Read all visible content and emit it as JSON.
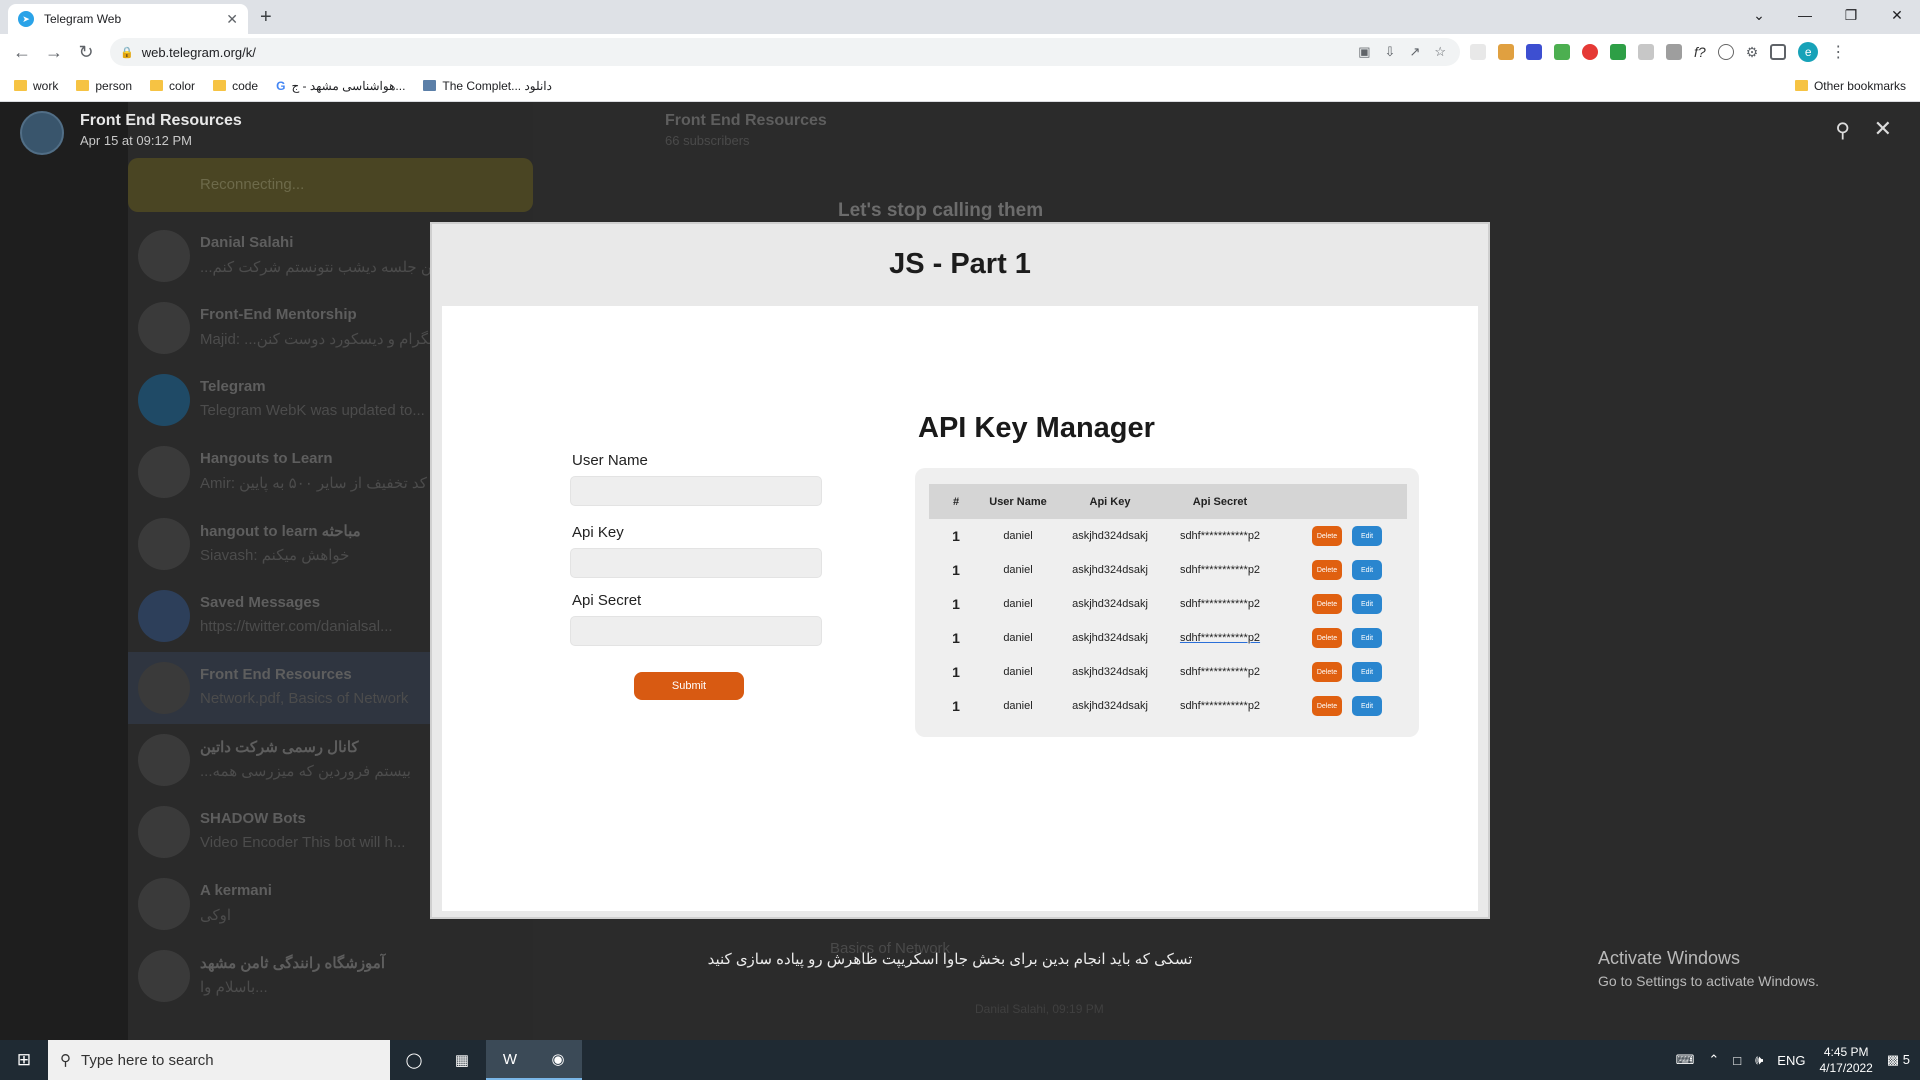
{
  "browser": {
    "tab_title": "Telegram Web",
    "url": "web.telegram.org/k/",
    "profile_initial": "e",
    "bookmarks": [
      "work",
      "person",
      "color",
      "code",
      "هواشناسی مشهد - ج...",
      "The Complet... دانلود"
    ],
    "other_bookmarks": "Other bookmarks"
  },
  "viewer": {
    "sender_name": "Front End Resources",
    "date": "Apr 15 at 09:12 PM",
    "caption": "تسکی که باید انجام بدین برای بخش جاوا اسکریپت ظاهرش رو پیاده سازی کنید"
  },
  "telegram_bg": {
    "reconnecting": "Reconnecting...",
    "chats": [
      {
        "name": "Danial Salahi",
        "preview": "...من جلسه دیشب نتونستم شرکت کنم"
      },
      {
        "name": "Front-End Mentorship",
        "preview": "Majid: ...تلگرام و دیسکورد دوست کنن"
      },
      {
        "name": "Telegram",
        "preview": "Telegram WebK was updated to..."
      },
      {
        "name": "Hangouts to Learn",
        "preview": "Amir: کد تخفیف از سایر ۵۰۰ به پایین"
      },
      {
        "name": "hangout to learn مباحثه",
        "preview": "Siavash: خواهش میکنم"
      },
      {
        "name": "Saved Messages",
        "preview": "https://twitter.com/danialsal..."
      },
      {
        "name": "Front End Resources",
        "preview": "Network.pdf, Basics of Network"
      },
      {
        "name": "کانال رسمی شرکت داتین",
        "preview": "...بیستم فروردین که میزرسی همه"
      },
      {
        "name": "SHADOW Bots",
        "preview": "Video Encoder This bot will h..."
      },
      {
        "name": "A kermani",
        "preview": "اوکی"
      },
      {
        "name": "آموزشگاه رانندگی ثامن مشهد",
        "preview": "باسلام وا..."
      }
    ],
    "channel_title": "Front End Resources",
    "channel_sub": "66 subscribers",
    "post_snippet": "Let's stop calling them",
    "file_name": "Basics of Network",
    "post_meta": "Danial Salahi, 09:19 PM"
  },
  "slide": {
    "heading": "JS - Part 1",
    "form": {
      "username_label": "User Name",
      "apikey_label": "Api Key",
      "apisecret_label": "Api Secret",
      "submit_label": "Submit"
    },
    "manager_title": "API Key Manager",
    "table": {
      "headers": [
        "#",
        "User Name",
        "Api Key",
        "Api Secret"
      ],
      "rows": [
        {
          "num": "1",
          "user": "daniel",
          "key": "askjhd324dsakj",
          "secret": "sdhf***********p2"
        },
        {
          "num": "1",
          "user": "daniel",
          "key": "askjhd324dsakj",
          "secret": "sdhf***********p2"
        },
        {
          "num": "1",
          "user": "daniel",
          "key": "askjhd324dsakj",
          "secret": "sdhf***********p2"
        },
        {
          "num": "1",
          "user": "daniel",
          "key": "askjhd324dsakj",
          "secret": "sdhf***********p2"
        },
        {
          "num": "1",
          "user": "daniel",
          "key": "askjhd324dsakj",
          "secret": "sdhf***********p2"
        },
        {
          "num": "1",
          "user": "daniel",
          "key": "askjhd324dsakj",
          "secret": "sdhf***********p2"
        }
      ],
      "delete_label": "Delete",
      "edit_label": "Edit"
    }
  },
  "windows": {
    "activate_title": "Activate Windows",
    "activate_sub": "Go to Settings to activate Windows.",
    "search_placeholder": "Type here to search",
    "lang": "ENG",
    "time": "4:45 PM",
    "date": "4/17/2022",
    "notif_count": "5"
  },
  "colors": {
    "submit": "#d85a12",
    "delete": "#e06010",
    "edit": "#2a86cf"
  }
}
